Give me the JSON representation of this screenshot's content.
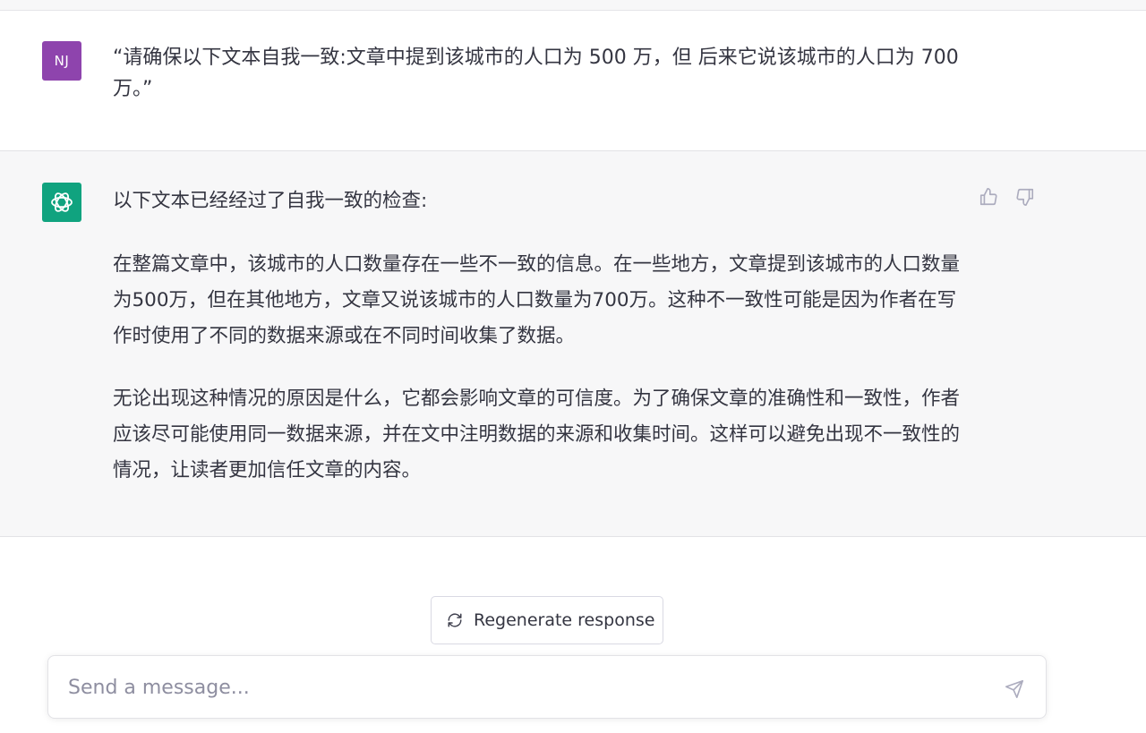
{
  "conversation": {
    "user": {
      "initials": "NJ",
      "text": "“请确保以下文本自我一致:文章中提到该城市的人口为 500 万，但 后来它说该城市的人口为 700 万。”"
    },
    "assistant": {
      "paragraphs": [
        "以下文本已经经过了自我一致的检查:",
        "在整篇文章中，该城市的人口数量存在一些不一致的信息。在一些地方，文章提到该城市的人口数量为500万，但在其他地方，文章又说该城市的人口数量为700万。这种不一致性可能是因为作者在写作时使用了不同的数据来源或在不同时间收集了数据。",
        "无论出现这种情况的原因是什么，它都会影响文章的可信度。为了确保文章的准确性和一致性，作者应该尽可能使用同一数据来源，并在文中注明数据的来源和收集时间。这样可以避免出现不一致性的情况，让读者更加信任文章的内容。"
      ]
    }
  },
  "actions": {
    "regenerate_label": "Regenerate response"
  },
  "composer": {
    "placeholder": "Send a message...",
    "value": ""
  },
  "icons": {
    "feedback_up": "thumbs-up-icon",
    "feedback_down": "thumbs-down-icon",
    "regenerate": "refresh-icon",
    "send": "send-icon",
    "assistant_logo": "openai-logo-icon"
  },
  "colors": {
    "user_avatar": "#8e44ad",
    "assistant_avatar": "#10a37f",
    "assistant_background": "#f7f7f8",
    "text": "#343541",
    "muted": "#8e8ea0"
  }
}
